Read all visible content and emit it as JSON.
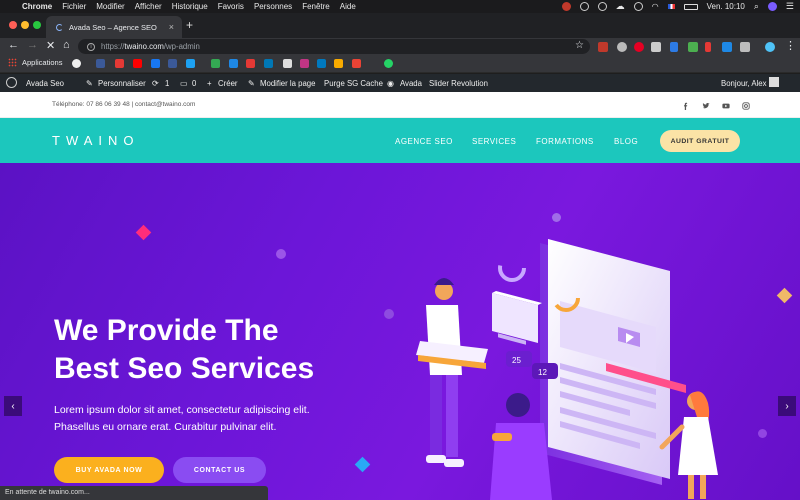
{
  "macos_menu": {
    "items": [
      "Chrome",
      "Fichier",
      "Modifier",
      "Afficher",
      "Historique",
      "Favoris",
      "Personnes",
      "Fenêtre",
      "Aide"
    ],
    "clock": "Ven. 10:10"
  },
  "browser": {
    "tab_title": "Avada Seo – Agence SEO",
    "url_scheme": "https://",
    "url_host": "twaino.com",
    "url_path": "/wp-admin",
    "bookmarks": {
      "apps_label": "Applications"
    },
    "status_text": "En attente de twaino.com..."
  },
  "wp_admin_bar": {
    "site_name": "Avada Seo",
    "customize": "Personnaliser",
    "updates_count": "1",
    "comments_count": "0",
    "new": "Créer",
    "edit_page": "Modifier la page",
    "purge": "Purge SG Cache",
    "avada": "Avada",
    "slider": "Slider Revolution",
    "greeting": "Bonjour, Alex"
  },
  "site": {
    "contact_line": "Téléphone: 07 86 06 39 48 | contact@twaino.com",
    "logo": "TWAINO",
    "nav": [
      "AGENCE SEO",
      "SERVICES",
      "FORMATIONS",
      "BLOG"
    ],
    "cta": "AUDIT GRATUIT",
    "hero_title_line1": "We Provide The",
    "hero_title_line2": "Best Seo Services",
    "hero_sub_line1": "Lorem ipsum dolor sit amet, consectetur adipiscing elit.",
    "hero_sub_line2": "Phasellus eu ornare erat. Curabitur pulvinar elit.",
    "btn_primary": "BUY AVADA NOW",
    "btn_secondary": "CONTACT US",
    "illus_badge_1": "25",
    "illus_badge_2": "12"
  },
  "colors": {
    "teal": "#1cc7bd",
    "purple": "#6c16d8",
    "yellow": "#fbb01e",
    "cta_bg": "#fbe3a6"
  }
}
